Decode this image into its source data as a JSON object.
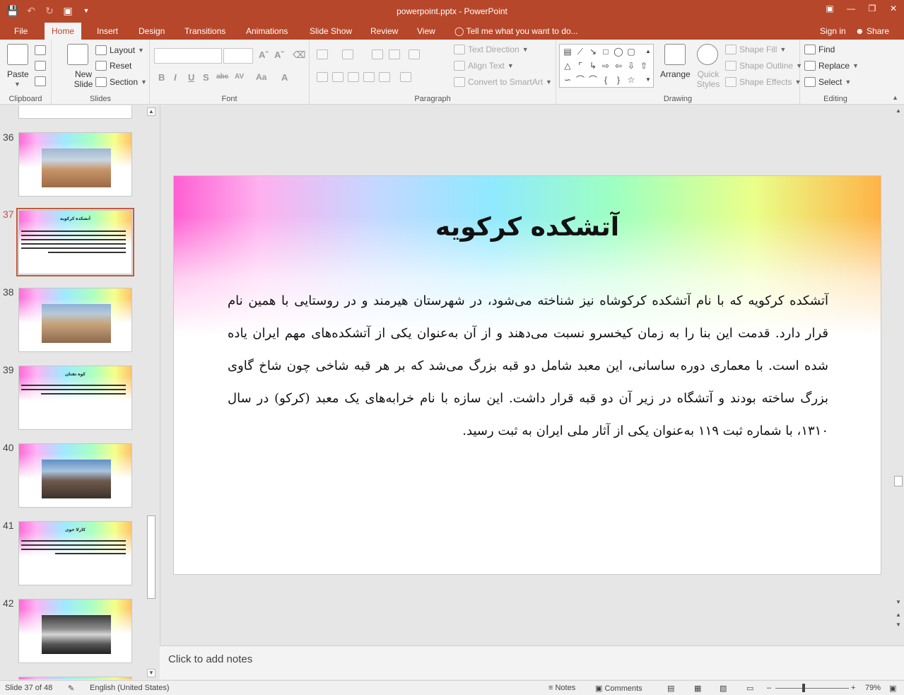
{
  "window": {
    "title": "powerpoint.pptx - PowerPoint"
  },
  "tabs": [
    {
      "label": "File"
    },
    {
      "label": "Home"
    },
    {
      "label": "Insert"
    },
    {
      "label": "Design"
    },
    {
      "label": "Transitions"
    },
    {
      "label": "Animations"
    },
    {
      "label": "Slide Show"
    },
    {
      "label": "Review"
    },
    {
      "label": "View"
    }
  ],
  "tell_me": "Tell me what you want to do...",
  "account": {
    "sign_in": "Sign in",
    "share": "Share"
  },
  "ribbon": {
    "clipboard": {
      "paste": "Paste",
      "label": "Clipboard"
    },
    "slides": {
      "new_slide": "New Slide",
      "layout": "Layout",
      "reset": "Reset",
      "section": "Section",
      "label": "Slides"
    },
    "font": {
      "label": "Font",
      "bold": "B",
      "italic": "I",
      "underline": "U",
      "shadow": "S",
      "strike": "abc",
      "spacing": "AV",
      "case": "Aa"
    },
    "paragraph": {
      "text_direction": "Text Direction",
      "align_text": "Align Text",
      "convert_smartart": "Convert to SmartArt",
      "label": "Paragraph"
    },
    "drawing": {
      "arrange": "Arrange",
      "quick_styles": "Quick Styles",
      "shape_fill": "Shape Fill",
      "shape_outline": "Shape Outline",
      "shape_effects": "Shape Effects",
      "label": "Drawing"
    },
    "editing": {
      "find": "Find",
      "replace": "Replace",
      "select": "Select",
      "label": "Editing"
    }
  },
  "thumbnails": [
    {
      "num": "36"
    },
    {
      "num": "37",
      "title": "آتشکده کرکویه"
    },
    {
      "num": "38"
    },
    {
      "num": "39",
      "title": "کوه تفتان"
    },
    {
      "num": "40"
    },
    {
      "num": "41",
      "title": "کارلا خوی"
    },
    {
      "num": "42"
    }
  ],
  "slide": {
    "title": "آتشکده کرکویه",
    "body": "آتشکده کرکویه که با نام آتشکده کرکوشاه نیز شناخته می‌شود، در شهرستان هیرمند و در روستایی با همین نام قرار دارد. قدمت این بنا را به زمان کیخسرو نسبت می‌دهند و از آن به‌عنوان یکی از آتشکده‌های مهم ایران یاده شده است. با معماری دوره ساسانی، این معبد شامل دو قبه بزرگ می‌شد که بر هر قبه شاخی چون شاخ گاوی بزرگ ساخته بودند و آتشگاه در زیر آن دو قبه قرار داشت. این سازه با نام خرابه‌های یک معبد (کرکو) در سال ۱۳۱۰، با شماره ثبت ۱۱۹ به‌عنوان یکی از آثار ملی ایران به ثبت رسید."
  },
  "notes": {
    "placeholder": "Click to add notes"
  },
  "status": {
    "slide": "Slide 37 of 48",
    "language": "English (United States)",
    "notes": "Notes",
    "comments": "Comments",
    "zoom": "79%"
  }
}
